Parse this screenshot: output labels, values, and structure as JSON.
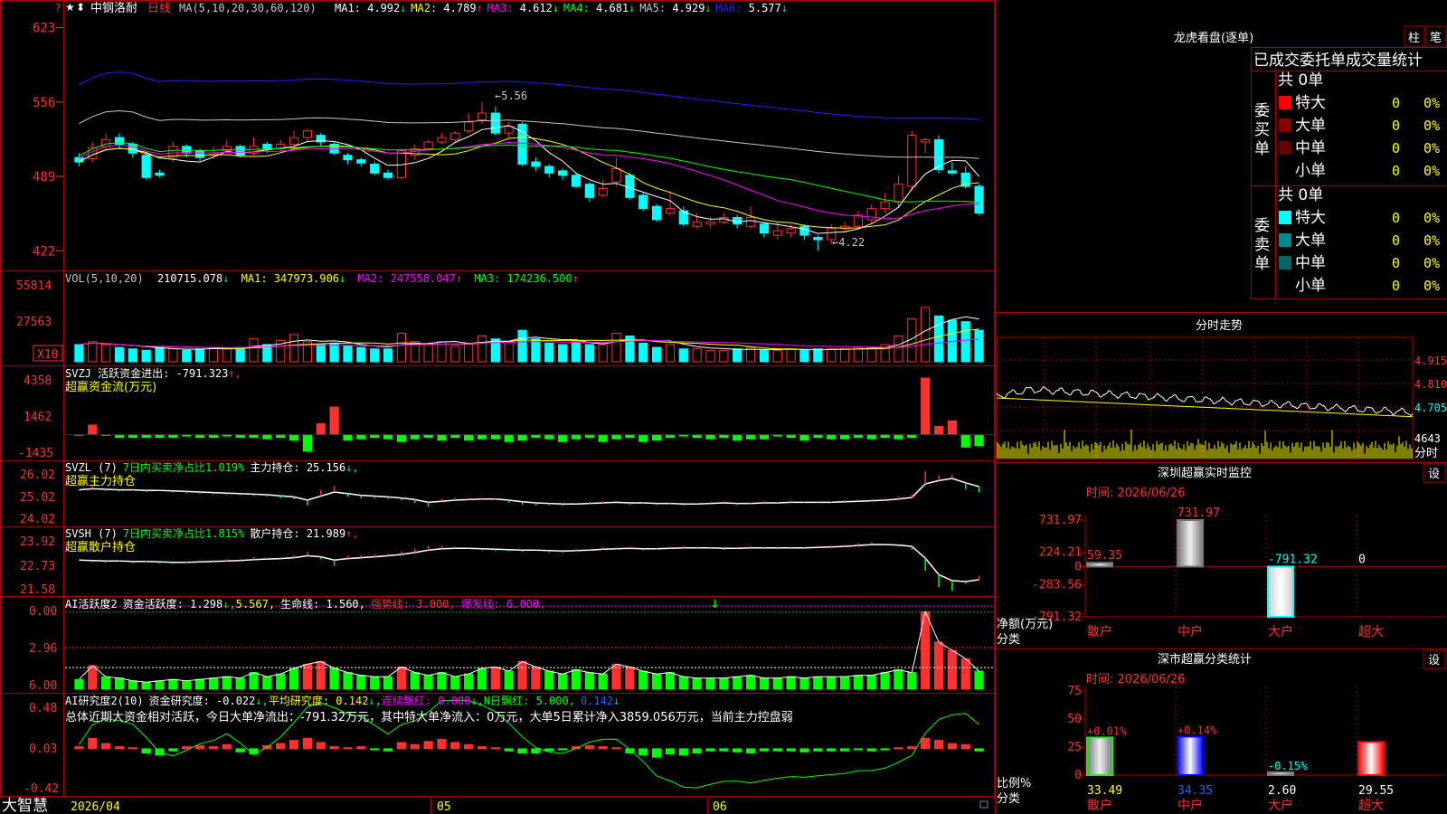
{
  "app": {
    "brand": "大智慧",
    "star": "★",
    "settings_icon": "?",
    "cursor_glyph": "⬍"
  },
  "colors": {
    "up": "#ff3030",
    "down": "#00ffff",
    "ma1": "#ffffff",
    "ma2": "#ffff00",
    "ma3": "#ff00ff",
    "ma4": "#00ff00",
    "ma5": "#c8c8c8",
    "ma6": "#2020ff",
    "grid": "#aa0000",
    "axis": "#ff3030"
  },
  "header": {
    "stock_name": "中钢洛耐",
    "period": "日线",
    "ma_params": "MA(5,10,20,30,60,120)",
    "ma": [
      {
        "label": "MA1:",
        "value": "4.992",
        "arrow": "↓"
      },
      {
        "label": "MA2:",
        "value": "4.789",
        "arrow": "↑"
      },
      {
        "label": "MA3:",
        "value": "4.612",
        "arrow": "↓"
      },
      {
        "label": "MA4:",
        "value": "4.681",
        "arrow": "↓"
      },
      {
        "label": "MA5:",
        "value": "4.929",
        "arrow": "↓"
      },
      {
        "label": "MA6:",
        "value": "5.577",
        "arrow": "↓"
      }
    ]
  },
  "main_yticks": [
    "623",
    "556",
    "489",
    "422"
  ],
  "annotations": {
    "high": "←5.56",
    "low": "←4.22"
  },
  "vol": {
    "label": "VOL(5,10,20)",
    "value": "210715.078",
    "v_arrow": "↓",
    "ma1": "MA1: 347973.906",
    "ma1_arrow": "↓",
    "ma2": "MA2: 247558.047",
    "ma2_arrow": "↑",
    "ma3": "MA3: 174236.500",
    "ma3_arrow": "↑",
    "yticks": [
      "55814",
      "27563"
    ],
    "unit": "X10"
  },
  "svzj": {
    "line1": "SVZJ  活跃资金进出: -791.323",
    "arrow": "↑,",
    "line2": "超赢资金流(万元)",
    "yticks": [
      "4358",
      "1462",
      "-1435"
    ]
  },
  "svzl": {
    "label": "SVZL (7)",
    "ratio": "7日内买卖净占比1.019%",
    "hold": "主力持仓: 25.156",
    "arrow": "↓,",
    "line2": "超赢主力持仓",
    "yticks": [
      "26.02",
      "25.02",
      "24.02"
    ]
  },
  "svsh": {
    "label": "SVSH (7)",
    "ratio": "7日内买卖净占比1.815%",
    "hold": "散户持仓: 21.989",
    "arrow": "↑,",
    "line2": "超赢散户持仓",
    "yticks": [
      "23.92",
      "22.73",
      "21.58"
    ]
  },
  "ai_active": {
    "label": "AI活跃度2",
    "v1": "资金活跃度: 1.298",
    "a1": "↓,",
    "v2": "5.567,",
    "v3": "生命线: 1.560,",
    "v4": "强势线: 3.000,",
    "v5": "爆发线: 6.000,",
    "mark": "↓",
    "yticks": [
      "6.00",
      "2.96",
      "0.00"
    ]
  },
  "ai_research": {
    "label": "AI研究度2(10)",
    "v1": "资金研究度: -0.022",
    "a1": "↓,",
    "v2": "平均研究度: 0.142",
    "a2": "↓,",
    "v3": "连续飘红: 0.000",
    "a3": "↓,",
    "v4": "N日飘红: 5.000,",
    "v5": "0.142",
    "a5": "↓",
    "summary": "总体近期大资金相对活跃，今日大单净流出：-791.32万元，其中特大单净流入：0万元，大单5日累计净入3859.056万元，当前主力控盘弱",
    "yticks": [
      "0.48",
      "0.03",
      "-0.42"
    ]
  },
  "xaxis": {
    "labels": [
      "2026/04",
      "05",
      "06"
    ]
  },
  "right": {
    "longhu": {
      "title": "龙虎看盘(逐单)",
      "btn1": "柱",
      "btn2": "笔",
      "tabs": [
        "已成交",
        "委托单",
        "成交量统计"
      ],
      "buy": {
        "side_label": "委买单",
        "total": "共 0单",
        "rows": [
          {
            "name": "特大",
            "val": "0",
            "pct": "0%",
            "color": "#ff0000"
          },
          {
            "name": "大单",
            "val": "0",
            "pct": "0%",
            "color": "#880000"
          },
          {
            "name": "中单",
            "val": "0",
            "pct": "0%",
            "color": "#660000"
          },
          {
            "name": "小单",
            "val": "0",
            "pct": "0%",
            "color": ""
          }
        ]
      },
      "sell": {
        "side_label": "委卖单",
        "total": "共 0单",
        "rows": [
          {
            "name": "特大",
            "val": "0",
            "pct": "0%",
            "color": "#00ffff"
          },
          {
            "name": "大单",
            "val": "0",
            "pct": "0%",
            "color": "#008888"
          },
          {
            "name": "中单",
            "val": "0",
            "pct": "0%",
            "color": "#006666"
          },
          {
            "name": "小单",
            "val": "0",
            "pct": "0%",
            "color": ""
          }
        ]
      }
    },
    "fenshi": {
      "title": "分时走势",
      "prices": [
        "4.915",
        "4.810",
        "4.705"
      ],
      "vol_tick": "4643",
      "vol_label": "分时"
    },
    "monitor": {
      "title": "深圳超赢实时监控",
      "btn": "设",
      "time": "时间: 2026/06/26",
      "yticks": [
        "731.97",
        "224.21",
        "0",
        "-283.56",
        "-791.32"
      ],
      "ylabel": "净额(万元)",
      "xlabel": "分类",
      "categories": [
        "散户",
        "中户",
        "大户",
        "超大"
      ],
      "values": [
        59.35,
        731.97,
        -791.32,
        0
      ],
      "labels": [
        "59.35",
        "731.97",
        "-791.32",
        "0"
      ]
    },
    "classify": {
      "title": "深市超赢分类统计",
      "btn": "设",
      "time": "时间: 2026/06/26",
      "yticks": [
        "75",
        "50",
        "25",
        "0"
      ],
      "ylabel": "比例%",
      "xlabel": "分类",
      "categories": [
        "散户",
        "中户",
        "大户",
        "超大"
      ],
      "values": [
        33.49,
        34.35,
        2.6,
        29.55
      ],
      "labels": [
        "33.49",
        "34.35",
        "2.60",
        "29.55"
      ],
      "changes": [
        "+0.01%",
        "+0.14%",
        "-0.15%",
        ""
      ]
    }
  },
  "chart_data": [
    {
      "type": "candlestick",
      "title": "中钢洛耐 日线",
      "ylabel": "",
      "yticks": [
        4.22,
        4.89,
        5.56,
        6.23
      ],
      "ylim": [
        4.1,
        6.3
      ],
      "x": [
        "2026/04",
        "",
        "",
        "",
        "",
        "",
        "",
        "",
        "",
        "",
        "",
        "",
        "",
        "",
        "",
        "",
        "",
        "",
        "",
        "",
        "",
        "",
        "",
        "",
        "05",
        "",
        "",
        "",
        "",
        "",
        "",
        "",
        "",
        "",
        "",
        "",
        "",
        "",
        "",
        "",
        "",
        "",
        "",
        "",
        "",
        "06",
        "",
        "",
        "",
        "",
        "",
        "",
        "",
        "",
        "",
        "",
        "",
        "",
        "",
        "",
        "",
        "",
        "",
        "",
        "",
        "",
        ""
      ],
      "candles": [
        [
          5.06,
          5.02,
          5.1,
          4.98
        ],
        [
          5.05,
          5.15,
          5.2,
          5.02
        ],
        [
          5.16,
          5.22,
          5.28,
          5.12
        ],
        [
          5.24,
          5.18,
          5.28,
          5.14
        ],
        [
          5.18,
          5.1,
          5.2,
          5.06
        ],
        [
          5.08,
          4.88,
          5.1,
          4.86
        ],
        [
          4.92,
          4.9,
          4.95,
          4.88
        ],
        [
          5.06,
          5.16,
          5.2,
          5.02
        ],
        [
          5.16,
          5.1,
          5.18,
          5.06
        ],
        [
          5.12,
          5.06,
          5.14,
          5.03
        ],
        [
          5.08,
          5.1,
          5.16,
          5.05
        ],
        [
          5.12,
          5.16,
          5.22,
          5.1
        ],
        [
          5.16,
          5.08,
          5.18,
          5.06
        ],
        [
          5.1,
          5.16,
          5.24,
          5.08
        ],
        [
          5.18,
          5.14,
          5.2,
          5.1
        ],
        [
          5.14,
          5.18,
          5.22,
          5.1
        ],
        [
          5.18,
          5.24,
          5.3,
          5.14
        ],
        [
          5.24,
          5.3,
          5.32,
          5.2
        ],
        [
          5.26,
          5.2,
          5.28,
          5.16
        ],
        [
          5.18,
          5.1,
          5.2,
          5.08
        ],
        [
          5.08,
          5.04,
          5.1,
          5.0
        ],
        [
          5.04,
          5.01,
          5.06,
          4.98
        ],
        [
          5.0,
          4.92,
          5.02,
          4.9
        ],
        [
          4.92,
          4.88,
          4.95,
          4.86
        ],
        [
          4.88,
          5.12,
          5.14,
          4.86
        ],
        [
          5.08,
          5.14,
          5.18,
          5.04
        ],
        [
          5.14,
          5.2,
          5.22,
          5.12
        ],
        [
          5.2,
          5.24,
          5.28,
          5.18
        ],
        [
          5.22,
          5.28,
          5.3,
          5.2
        ],
        [
          5.3,
          5.38,
          5.46,
          5.28
        ],
        [
          5.4,
          5.46,
          5.56,
          5.36
        ],
        [
          5.46,
          5.28,
          5.52,
          5.26
        ],
        [
          5.28,
          5.34,
          5.38,
          5.24
        ],
        [
          5.36,
          5.0,
          5.38,
          4.98
        ],
        [
          5.02,
          4.98,
          5.06,
          4.94
        ],
        [
          4.98,
          4.92,
          5.0,
          4.88
        ],
        [
          4.94,
          4.9,
          4.96,
          4.86
        ],
        [
          4.9,
          4.8,
          4.92,
          4.78
        ],
        [
          4.82,
          4.7,
          4.84,
          4.66
        ],
        [
          4.72,
          4.78,
          4.86,
          4.7
        ],
        [
          4.84,
          4.96,
          5.06,
          4.8
        ],
        [
          4.9,
          4.7,
          4.92,
          4.68
        ],
        [
          4.72,
          4.6,
          4.74,
          4.58
        ],
        [
          4.62,
          4.5,
          4.64,
          4.48
        ],
        [
          4.56,
          4.6,
          4.76,
          4.54
        ],
        [
          4.58,
          4.46,
          4.62,
          4.44
        ],
        [
          4.44,
          4.48,
          4.56,
          4.42
        ],
        [
          4.46,
          4.48,
          4.52,
          4.42
        ],
        [
          4.48,
          4.52,
          4.56,
          4.46
        ],
        [
          4.52,
          4.46,
          4.54,
          4.42
        ],
        [
          4.44,
          4.52,
          4.62,
          4.42
        ],
        [
          4.46,
          4.38,
          4.48,
          4.34
        ],
        [
          4.36,
          4.4,
          4.48,
          4.32
        ],
        [
          4.38,
          4.42,
          4.46,
          4.34
        ],
        [
          4.44,
          4.36,
          4.46,
          4.32
        ],
        [
          4.34,
          4.32,
          4.36,
          4.22
        ],
        [
          4.32,
          4.42,
          4.46,
          4.28
        ],
        [
          4.42,
          4.44,
          4.48,
          4.38
        ],
        [
          4.44,
          4.54,
          4.58,
          4.42
        ],
        [
          4.5,
          4.6,
          4.64,
          4.46
        ],
        [
          4.6,
          4.66,
          4.74,
          4.56
        ],
        [
          4.66,
          4.82,
          4.9,
          4.62
        ],
        [
          4.8,
          5.26,
          5.3,
          4.76
        ],
        [
          5.2,
          5.22,
          5.24,
          5.1
        ],
        [
          5.22,
          4.95,
          5.26,
          4.92
        ],
        [
          4.94,
          4.92,
          5.02,
          4.9
        ],
        [
          4.92,
          4.8,
          4.98,
          4.78
        ],
        [
          4.8,
          4.56,
          4.82,
          4.54
        ]
      ]
    },
    {
      "type": "bar",
      "title": "VOL(5,10,20)",
      "unit": "X10",
      "ylim": [
        0,
        60000
      ],
      "yticks": [
        27563,
        55814
      ],
      "values": [
        12000,
        14000,
        12000,
        10000,
        9000,
        8000,
        10000,
        9000,
        8000,
        9000,
        10000,
        9000,
        10000,
        16000,
        12000,
        15000,
        19000,
        14000,
        12000,
        13000,
        11000,
        10000,
        9000,
        9000,
        20000,
        14000,
        12000,
        14000,
        11000,
        13000,
        18000,
        16000,
        14000,
        22000,
        16000,
        13000,
        12000,
        14000,
        12000,
        12000,
        20000,
        18000,
        13000,
        10000,
        12000,
        9000,
        9000,
        8000,
        8000,
        9000,
        10000,
        8000,
        8000,
        9000,
        8000,
        9000,
        9000,
        9000,
        10000,
        10000,
        12000,
        18000,
        30000,
        38000,
        32000,
        29000,
        28000,
        22000
      ]
    },
    {
      "type": "bar",
      "title": "超赢资金流(万元)",
      "ylim": [
        -1600,
        4500
      ],
      "yticks": [
        -1435,
        1462,
        4358
      ],
      "values": [
        0,
        700,
        0,
        -200,
        -200,
        -200,
        -200,
        -200,
        -100,
        -200,
        -200,
        -100,
        -200,
        -200,
        -300,
        -200,
        -400,
        -1200,
        800,
        2000,
        -400,
        -300,
        -200,
        -300,
        -500,
        -300,
        -200,
        -400,
        -200,
        -400,
        -300,
        -300,
        -500,
        -400,
        -200,
        -300,
        -500,
        -300,
        -200,
        -500,
        -300,
        -200,
        -500,
        -400,
        -200,
        -100,
        -200,
        -300,
        -200,
        -400,
        -300,
        -300,
        -100,
        -200,
        -400,
        -200,
        -300,
        -300,
        -200,
        -300,
        -200,
        -300,
        -200,
        4100,
        600,
        1000,
        -900,
        -800
      ]
    },
    {
      "type": "line",
      "title": "超赢主力持仓",
      "ylim": [
        23.9,
        26.1
      ],
      "yticks": [
        24.02,
        25.02,
        26.02
      ],
      "values": [
        25.18,
        25.22,
        25.2,
        25.18,
        25.18,
        25.16,
        25.16,
        25.14,
        25.12,
        25.1,
        25.08,
        25.06,
        25.04,
        25.02,
        25.0,
        24.96,
        24.92,
        24.8,
        24.95,
        25.1,
        25.04,
        24.98,
        24.95,
        24.92,
        24.88,
        24.82,
        24.72,
        24.76,
        24.8,
        24.82,
        24.84,
        24.84,
        24.8,
        24.74,
        24.7,
        24.68,
        24.66,
        24.66,
        24.68,
        24.7,
        24.72,
        24.7,
        24.7,
        24.68,
        24.68,
        24.66,
        24.66,
        24.68,
        24.7,
        24.68,
        24.68,
        24.7,
        24.7,
        24.72,
        24.72,
        24.72,
        24.72,
        24.74,
        24.76,
        24.78,
        24.8,
        24.84,
        24.9,
        25.4,
        25.52,
        25.6,
        25.44,
        25.3
      ]
    },
    {
      "type": "line",
      "title": "超赢散户持仓",
      "ylim": [
        21.4,
        24.1
      ],
      "yticks": [
        21.58,
        22.73,
        23.92
      ],
      "values": [
        22.82,
        22.8,
        22.78,
        22.78,
        22.76,
        22.76,
        22.74,
        22.72,
        22.72,
        22.74,
        22.76,
        22.78,
        22.8,
        22.84,
        22.86,
        22.88,
        22.92,
        23.0,
        22.96,
        22.82,
        22.88,
        22.92,
        22.96,
        23.0,
        23.06,
        23.14,
        23.24,
        23.3,
        23.32,
        23.32,
        23.3,
        23.28,
        23.26,
        23.24,
        23.24,
        23.22,
        23.2,
        23.22,
        23.24,
        23.28,
        23.3,
        23.32,
        23.3,
        23.3,
        23.32,
        23.34,
        23.34,
        23.34,
        23.32,
        23.32,
        23.34,
        23.34,
        23.34,
        23.34,
        23.34,
        23.36,
        23.38,
        23.4,
        23.44,
        23.48,
        23.48,
        23.46,
        23.4,
        22.9,
        22.2,
        21.94,
        21.9,
        21.98
      ]
    },
    {
      "type": "bar",
      "title": "AI活跃度2",
      "ylim": [
        0,
        6.4
      ],
      "yticks": [
        0,
        2.96,
        6.0
      ],
      "values": [
        0.7,
        1.7,
        0.9,
        0.8,
        0.6,
        0.5,
        0.6,
        0.7,
        0.6,
        0.7,
        0.8,
        0.9,
        0.8,
        1.2,
        0.9,
        1.1,
        1.5,
        1.8,
        2.0,
        1.5,
        1.2,
        1.0,
        0.9,
        0.9,
        1.6,
        1.2,
        1.0,
        1.2,
        0.9,
        1.1,
        1.5,
        1.6,
        1.3,
        2.0,
        1.6,
        1.3,
        1.1,
        1.4,
        1.2,
        1.1,
        1.8,
        1.6,
        1.3,
        1.1,
        1.2,
        0.9,
        0.8,
        0.8,
        0.8,
        0.9,
        1.0,
        0.8,
        0.8,
        0.9,
        0.8,
        0.9,
        0.9,
        0.9,
        1.0,
        1.0,
        1.2,
        1.4,
        1.2,
        5.6,
        3.4,
        2.8,
        2.2,
        1.3
      ]
    },
    {
      "type": "bar",
      "title": "AI研究度2(10)",
      "ylim": [
        -0.45,
        0.5
      ],
      "yticks": [
        -0.42,
        0.03,
        0.48
      ],
      "values": [
        0.02,
        0.1,
        0.05,
        0.02,
        0.01,
        -0.04,
        -0.06,
        -0.02,
        0.02,
        0.03,
        0.02,
        0.04,
        -0.03,
        -0.05,
        0.03,
        0.05,
        0.08,
        0.1,
        0.06,
        0.02,
        0.01,
        0.02,
        -0.01,
        -0.02,
        0.06,
        0.04,
        0.07,
        0.09,
        0.06,
        0.04,
        0.02,
        0.01,
        -0.02,
        -0.04,
        -0.04,
        -0.02,
        -0.01,
        0.02,
        0.03,
        0.02,
        0.01,
        -0.04,
        -0.06,
        -0.08,
        -0.05,
        -0.06,
        -0.04,
        -0.02,
        -0.02,
        -0.03,
        -0.04,
        -0.02,
        -0.02,
        -0.02,
        -0.03,
        -0.02,
        -0.02,
        -0.02,
        -0.01,
        -0.02,
        -0.01,
        0.01,
        0.02,
        0.1,
        0.08,
        0.05,
        0.04,
        -0.02
      ]
    }
  ]
}
